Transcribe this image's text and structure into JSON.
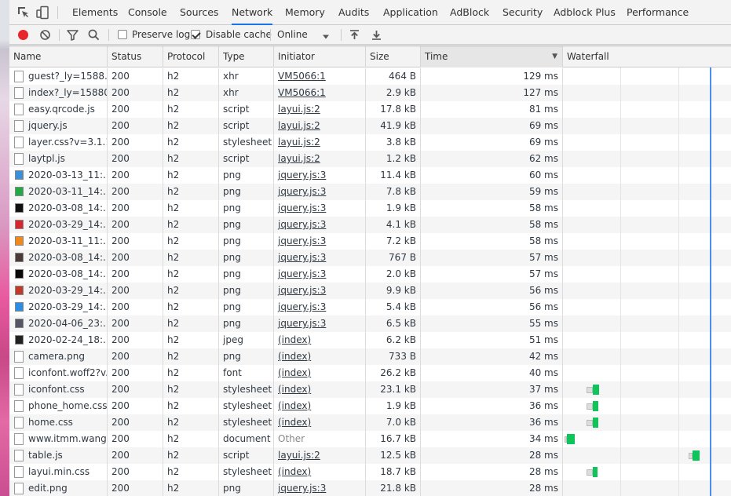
{
  "tabs": [
    "Elements",
    "Console",
    "Sources",
    "Network",
    "Memory",
    "Audits",
    "Application",
    "AdBlock",
    "Security",
    "Adblock Plus",
    "Performance"
  ],
  "active_tab": "Network",
  "toolbar": {
    "preserve_log": "Preserve log",
    "disable_cache": "Disable cache",
    "throttling": "Online"
  },
  "columns": [
    "Name",
    "Status",
    "Protocol",
    "Type",
    "Initiator",
    "Size",
    "Time",
    "Waterfall"
  ],
  "sorted_column": "Time",
  "colors": {
    "accent": "#1a73e8",
    "record": "#e8252b",
    "waterfall_bar": "#0fc45a",
    "waterfall_line": "#4a8ef0"
  },
  "rows": [
    {
      "name": "guest?_ly=1588...",
      "status": "200",
      "protocol": "h2",
      "type": "xhr",
      "initiator": "VM5066:1",
      "size": "464 B",
      "time": "129 ms",
      "icon": "doc"
    },
    {
      "name": "index?_ly=15880...",
      "status": "200",
      "protocol": "h2",
      "type": "xhr",
      "initiator": "VM5066:1",
      "size": "2.9 kB",
      "time": "127 ms",
      "icon": "doc"
    },
    {
      "name": "easy.qrcode.js",
      "status": "200",
      "protocol": "h2",
      "type": "script",
      "initiator": "layui.js:2",
      "size": "17.8 kB",
      "time": "81 ms",
      "icon": "doc"
    },
    {
      "name": "jquery.js",
      "status": "200",
      "protocol": "h2",
      "type": "script",
      "initiator": "layui.js:2",
      "size": "41.9 kB",
      "time": "69 ms",
      "icon": "doc"
    },
    {
      "name": "layer.css?v=3.1.1",
      "status": "200",
      "protocol": "h2",
      "type": "stylesheet",
      "initiator": "layui.js:2",
      "size": "3.8 kB",
      "time": "69 ms",
      "icon": "doc"
    },
    {
      "name": "laytpl.js",
      "status": "200",
      "protocol": "h2",
      "type": "script",
      "initiator": "layui.js:2",
      "size": "1.2 kB",
      "time": "62 ms",
      "icon": "doc"
    },
    {
      "name": "2020-03-13_11:...",
      "status": "200",
      "protocol": "h2",
      "type": "png",
      "initiator": "jquery.js:3",
      "size": "11.4 kB",
      "time": "60 ms",
      "icon": "#3a8fd6"
    },
    {
      "name": "2020-03-11_14:...",
      "status": "200",
      "protocol": "h2",
      "type": "png",
      "initiator": "jquery.js:3",
      "size": "7.8 kB",
      "time": "59 ms",
      "icon": "#22a845"
    },
    {
      "name": "2020-03-08_14:...",
      "status": "200",
      "protocol": "h2",
      "type": "png",
      "initiator": "jquery.js:3",
      "size": "1.9 kB",
      "time": "58 ms",
      "icon": "#111111"
    },
    {
      "name": "2020-03-29_14:...",
      "status": "200",
      "protocol": "h2",
      "type": "png",
      "initiator": "jquery.js:3",
      "size": "4.1 kB",
      "time": "58 ms",
      "icon": "#d8262e"
    },
    {
      "name": "2020-03-11_11:...",
      "status": "200",
      "protocol": "h2",
      "type": "png",
      "initiator": "jquery.js:3",
      "size": "7.2 kB",
      "time": "58 ms",
      "icon": "#f08a1c"
    },
    {
      "name": "2020-03-08_14:...",
      "status": "200",
      "protocol": "h2",
      "type": "png",
      "initiator": "jquery.js:3",
      "size": "767 B",
      "time": "57 ms",
      "icon": "#4a3a3a"
    },
    {
      "name": "2020-03-08_14:...",
      "status": "200",
      "protocol": "h2",
      "type": "png",
      "initiator": "jquery.js:3",
      "size": "2.0 kB",
      "time": "57 ms",
      "icon": "#0a0a0a"
    },
    {
      "name": "2020-03-29_14:...",
      "status": "200",
      "protocol": "h2",
      "type": "png",
      "initiator": "jquery.js:3",
      "size": "9.9 kB",
      "time": "56 ms",
      "icon": "#c0392b"
    },
    {
      "name": "2020-03-29_14:...",
      "status": "200",
      "protocol": "h2",
      "type": "png",
      "initiator": "jquery.js:3",
      "size": "5.4 kB",
      "time": "56 ms",
      "icon": "#2d8de0"
    },
    {
      "name": "2020-04-06_23:...",
      "status": "200",
      "protocol": "h2",
      "type": "png",
      "initiator": "jquery.js:3",
      "size": "6.5 kB",
      "time": "55 ms",
      "icon": "#555566"
    },
    {
      "name": "2020-02-24_18:...",
      "status": "200",
      "protocol": "h2",
      "type": "jpeg",
      "initiator": "(index)",
      "size": "6.2 kB",
      "time": "51 ms",
      "icon": "#222222"
    },
    {
      "name": "camera.png",
      "status": "200",
      "protocol": "h2",
      "type": "png",
      "initiator": "(index)",
      "size": "733 B",
      "time": "42 ms",
      "icon": "doc"
    },
    {
      "name": "iconfont.woff2?v...",
      "status": "200",
      "protocol": "h2",
      "type": "font",
      "initiator": "(index)",
      "size": "26.2 kB",
      "time": "40 ms",
      "icon": "doc"
    },
    {
      "name": "iconfont.css",
      "status": "200",
      "protocol": "h2",
      "type": "stylesheet",
      "initiator": "(index)",
      "size": "23.1 kB",
      "time": "37 ms",
      "icon": "doc"
    },
    {
      "name": "phone_home.css",
      "status": "200",
      "protocol": "h2",
      "type": "stylesheet",
      "initiator": "(index)",
      "size": "1.9 kB",
      "time": "36 ms",
      "icon": "doc"
    },
    {
      "name": "home.css",
      "status": "200",
      "protocol": "h2",
      "type": "stylesheet",
      "initiator": "(index)",
      "size": "7.0 kB",
      "time": "36 ms",
      "icon": "doc"
    },
    {
      "name": "www.itmm.wang",
      "status": "200",
      "protocol": "h2",
      "type": "document",
      "initiator": "Other",
      "size": "16.7 kB",
      "time": "34 ms",
      "icon": "doc"
    },
    {
      "name": "table.js",
      "status": "200",
      "protocol": "h2",
      "type": "script",
      "initiator": "layui.js:2",
      "size": "12.5 kB",
      "time": "28 ms",
      "icon": "doc"
    },
    {
      "name": "layui.min.css",
      "status": "200",
      "protocol": "h2",
      "type": "stylesheet",
      "initiator": "(index)",
      "size": "18.7 kB",
      "time": "28 ms",
      "icon": "doc"
    },
    {
      "name": "edit.png",
      "status": "200",
      "protocol": "h2",
      "type": "png",
      "initiator": "jquery.js:3",
      "size": "21.8 kB",
      "time": "28 ms",
      "icon": "doc"
    }
  ]
}
